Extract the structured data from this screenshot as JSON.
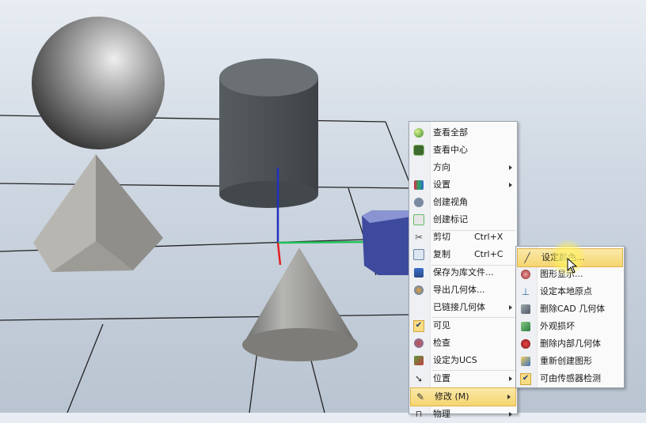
{
  "window": {
    "title_blurred": ""
  },
  "scene": {
    "objects": [
      "sphere",
      "cylinder",
      "pyramid",
      "cone",
      "box"
    ],
    "grid": true
  },
  "context_menu": {
    "items": [
      {
        "id": "view-all",
        "label": "查看全部",
        "icon": "view-all-icon",
        "submenu": false
      },
      {
        "id": "view-center",
        "label": "查看中心",
        "icon": "view-center-icon",
        "submenu": false
      },
      {
        "id": "orientation",
        "label": "方向",
        "icon": "",
        "submenu": true
      },
      {
        "id": "settings",
        "label": "设置",
        "icon": "settings-icon",
        "submenu": true
      },
      {
        "id": "create-view",
        "label": "创建视角",
        "icon": "camera-icon",
        "submenu": false
      },
      {
        "id": "create-marker",
        "label": "创建标记",
        "icon": "marker-icon",
        "submenu": false
      },
      {
        "id": "cut",
        "label": "剪切",
        "shortcut": "Ctrl+X",
        "icon": "scissors-icon",
        "submenu": false
      },
      {
        "id": "copy",
        "label": "复制",
        "shortcut": "Ctrl+C",
        "icon": "copy-icon",
        "submenu": false
      },
      {
        "id": "save-library",
        "label": "保存为库文件...",
        "icon": "save-library-icon",
        "submenu": false
      },
      {
        "id": "export-geometry",
        "label": "导出几何体...",
        "icon": "export-icon",
        "submenu": false
      },
      {
        "id": "linked-geometry",
        "label": "已链接几何体",
        "icon": "",
        "submenu": true
      },
      {
        "id": "visible",
        "label": "可见",
        "icon": "check-icon",
        "submenu": false,
        "checked": true
      },
      {
        "id": "inspect",
        "label": "检查",
        "icon": "inspect-icon",
        "submenu": false
      },
      {
        "id": "set-ucs",
        "label": "设定为UCS",
        "icon": "ucs-icon",
        "submenu": false
      },
      {
        "id": "position",
        "label": "位置",
        "icon": "position-icon",
        "submenu": true
      },
      {
        "id": "modify",
        "label": "修改 (M)",
        "icon": "pencil-icon",
        "submenu": true,
        "highlighted": true
      },
      {
        "id": "physics",
        "label": "物理",
        "icon": "physics-icon",
        "submenu": true
      }
    ]
  },
  "submenu": {
    "items": [
      {
        "id": "set-color",
        "label": "设定颜色...",
        "icon": "brush-icon",
        "highlighted": true
      },
      {
        "id": "graphic-display",
        "label": "图形显示...",
        "icon": "display-icon"
      },
      {
        "id": "set-local-origin",
        "label": "设定本地原点",
        "icon": "origin-icon"
      },
      {
        "id": "delete-cad",
        "label": "删除CAD 几何体",
        "icon": "delete-cad-icon"
      },
      {
        "id": "appearance-damage",
        "label": "外观损坏",
        "icon": "damage-icon"
      },
      {
        "id": "delete-inner",
        "label": "删除内部几何体",
        "icon": "delete-inner-icon"
      },
      {
        "id": "recreate-graphics",
        "label": "重新创建图形",
        "icon": "recreate-icon"
      },
      {
        "id": "sensor-detect",
        "label": "可由传感器检测",
        "icon": "check-icon",
        "checked": true
      }
    ]
  },
  "colors": {
    "menu_highlight": "#f5d56f",
    "box_blue": "#3d4a9e",
    "axis_x": "#22c25a",
    "axis_y": "#e02020",
    "axis_z": "#2030c0"
  }
}
